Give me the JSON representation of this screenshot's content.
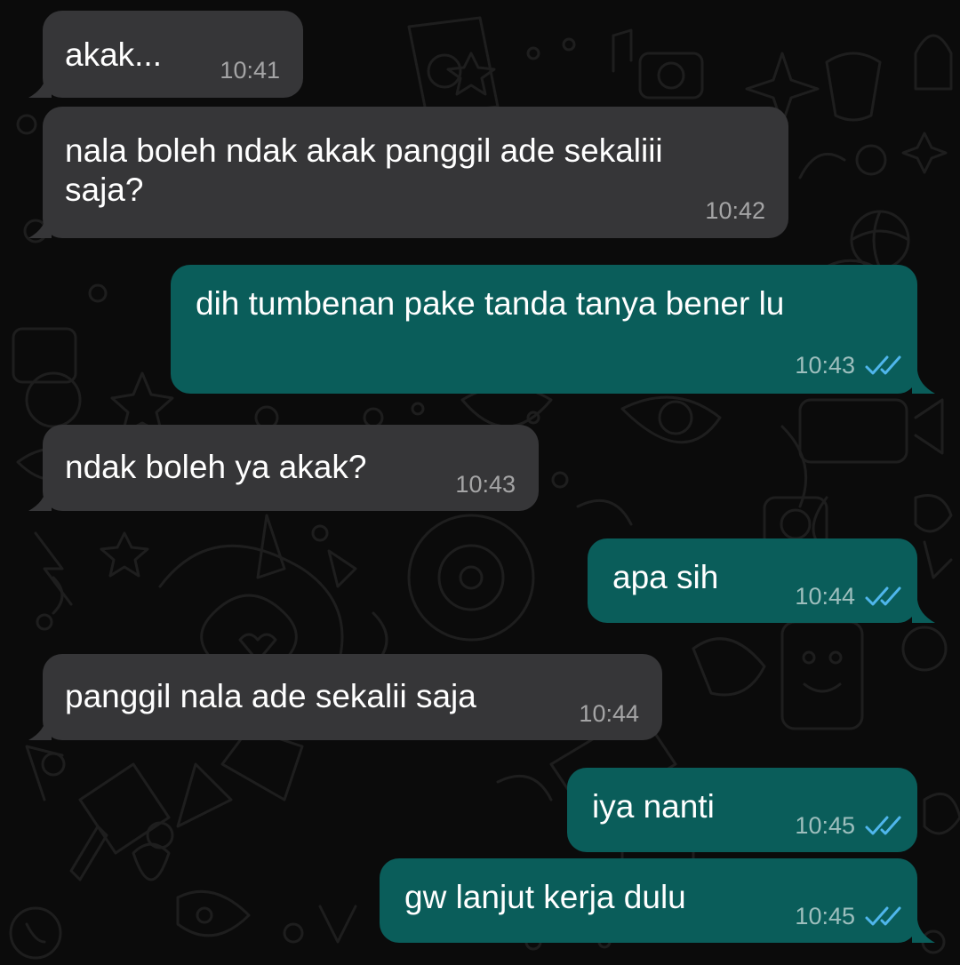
{
  "chat": {
    "messages": [
      {
        "direction": "incoming",
        "text": "akak...",
        "time": "10:41"
      },
      {
        "direction": "incoming",
        "text_lines": [
          "nala boleh ndak akak panggil ade sekaliii",
          "saja?"
        ],
        "time": "10:42"
      },
      {
        "direction": "outgoing",
        "text": "dih tumbenan pake tanda tanya bener lu",
        "time": "10:43",
        "status": "read"
      },
      {
        "direction": "incoming",
        "text": "ndak boleh ya akak?",
        "time": "10:43"
      },
      {
        "direction": "outgoing",
        "text": "apa sih",
        "time": "10:44",
        "status": "read"
      },
      {
        "direction": "incoming",
        "text": "panggil nala ade sekalii saja",
        "time": "10:44"
      },
      {
        "direction": "outgoing",
        "text": "iya nanti",
        "time": "10:45",
        "status": "read"
      },
      {
        "direction": "outgoing",
        "text": "gw lanjut kerja dulu",
        "time": "10:45",
        "status": "read"
      }
    ]
  },
  "colors": {
    "background": "#0b0b0b",
    "incoming_bubble": "#363638",
    "outgoing_bubble": "#0a5d5a",
    "read_ticks": "#4fb6ec",
    "doodle": "#1c1c1c"
  },
  "icons": {
    "wallpaper": "doodle-pattern-icon",
    "read_receipt": "double-check-icon"
  }
}
